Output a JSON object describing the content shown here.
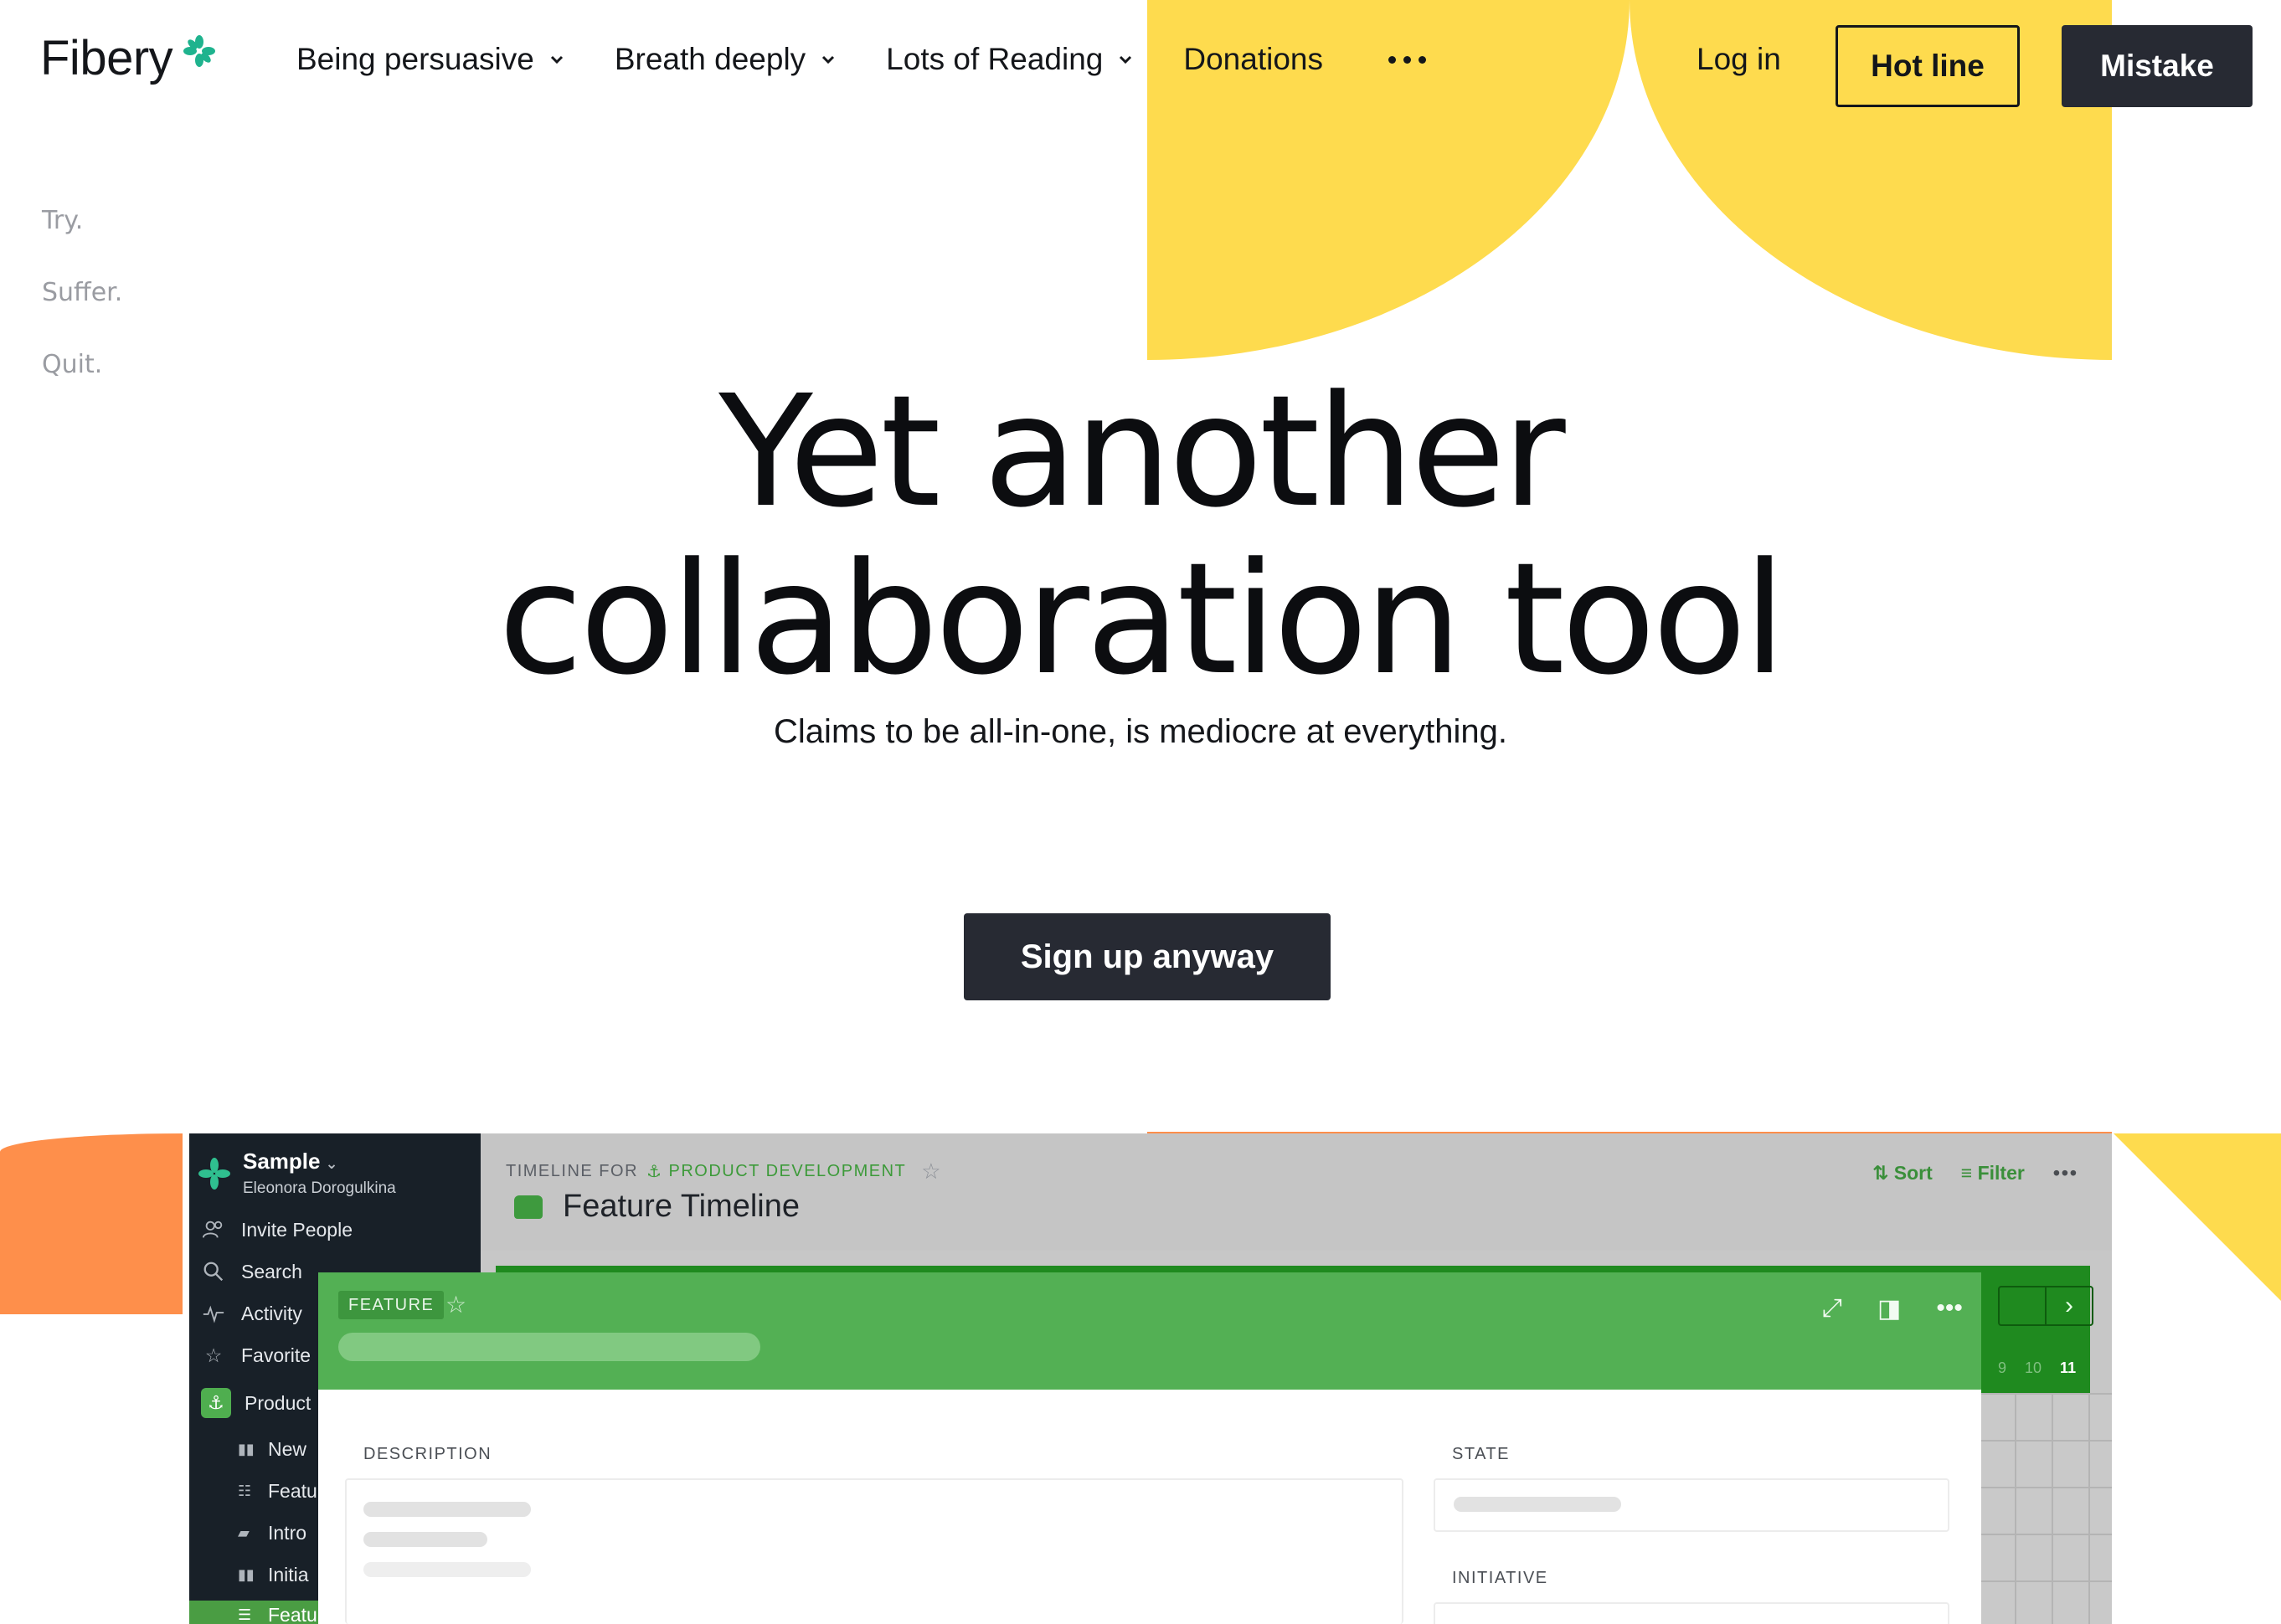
{
  "header": {
    "logo_text": "Fibery",
    "nav": [
      {
        "label": "Being persuasive",
        "has_dropdown": true
      },
      {
        "label": "Breath deeply",
        "has_dropdown": true
      },
      {
        "label": "Lots of Reading",
        "has_dropdown": true
      },
      {
        "label": "Donations",
        "has_dropdown": false
      }
    ],
    "more_icon": "ellipsis-icon",
    "login_label": "Log in",
    "hotline_label": "Hot line",
    "mistake_label": "Mistake"
  },
  "taglines": [
    "Try.",
    "Suffer.",
    "Quit."
  ],
  "hero": {
    "title_line1": "Yet another",
    "title_line2": "collaboration tool",
    "subtitle": "Claims to be all-in-one, is mediocre at everything.",
    "cta_label": "Sign up anyway"
  },
  "app": {
    "workspace_name": "Sample",
    "workspace_user": "Eleonora Dorogulkina",
    "sidebar": {
      "invite": "Invite People",
      "search": "Search",
      "activity": "Activity",
      "favorites": "Favorite",
      "product": "Product",
      "sub_items": [
        "New",
        "Featu",
        "Intro",
        "Initia",
        "Featu"
      ]
    },
    "timeline_for": "TIMELINE FOR",
    "space_name": "PRODUCT DEVELOPMENT",
    "view_title": "Feature Timeline",
    "sort_label": "Sort",
    "filter_label": "Filter",
    "day_numbers": [
      "9",
      "10",
      "11"
    ],
    "card": {
      "type_badge": "FEATURE",
      "description_label": "DESCRIPTION",
      "state_label": "STATE",
      "initiative_label": "INITIATIVE"
    }
  },
  "colors": {
    "accent_yellow": "#fedb4e",
    "accent_orange": "#fe8f4b",
    "dark_button": "#272a33",
    "brand_green": "#1fb38e",
    "app_green": "#53b054"
  }
}
